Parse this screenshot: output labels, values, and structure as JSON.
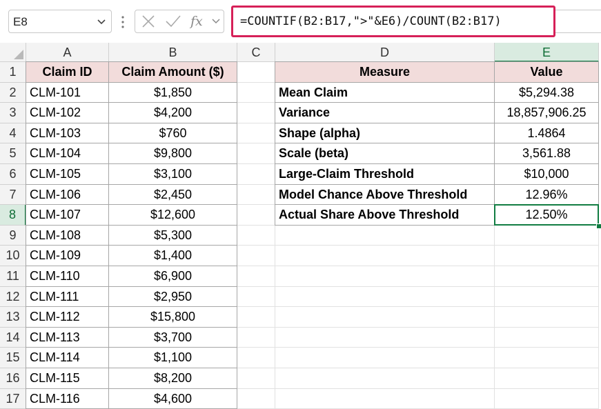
{
  "name_box": {
    "value": "E8"
  },
  "formula_bar": {
    "fx_label": "fx",
    "formula": "=COUNTIF(B2:B17,\">\"&E6)/COUNT(B2:B17)"
  },
  "column_headers": [
    "A",
    "B",
    "C",
    "D",
    "E"
  ],
  "row_headers": [
    "1",
    "2",
    "3",
    "4",
    "5",
    "6",
    "7",
    "8",
    "9",
    "10",
    "11",
    "12",
    "13",
    "14",
    "15",
    "16",
    "17"
  ],
  "selected_cell": "E8",
  "claims_table": {
    "headers": [
      "Claim ID",
      "Claim Amount ($)"
    ],
    "rows": [
      [
        "CLM-101",
        "$1,850"
      ],
      [
        "CLM-102",
        "$4,200"
      ],
      [
        "CLM-103",
        "$760"
      ],
      [
        "CLM-104",
        "$9,800"
      ],
      [
        "CLM-105",
        "$3,100"
      ],
      [
        "CLM-106",
        "$2,450"
      ],
      [
        "CLM-107",
        "$12,600"
      ],
      [
        "CLM-108",
        "$5,300"
      ],
      [
        "CLM-109",
        "$1,400"
      ],
      [
        "CLM-110",
        "$6,900"
      ],
      [
        "CLM-111",
        "$2,950"
      ],
      [
        "CLM-112",
        "$15,800"
      ],
      [
        "CLM-113",
        "$3,700"
      ],
      [
        "CLM-114",
        "$1,100"
      ],
      [
        "CLM-115",
        "$8,200"
      ],
      [
        "CLM-116",
        "$4,600"
      ]
    ]
  },
  "measures_table": {
    "headers": [
      "Measure",
      "Value"
    ],
    "rows": [
      [
        "Mean Claim",
        "$5,294.38"
      ],
      [
        "Variance",
        "18,857,906.25"
      ],
      [
        "Shape (alpha)",
        "1.4864"
      ],
      [
        "Scale (beta)",
        "3,561.88"
      ],
      [
        "Large-Claim Threshold",
        "$10,000"
      ],
      [
        "Model Chance Above Threshold",
        "12.96%"
      ],
      [
        "Actual Share Above Threshold",
        "12.50%"
      ]
    ]
  },
  "colors": {
    "header_fill": "#f2dcdb",
    "selection_green": "#107c41",
    "formula_highlight": "#d62058"
  }
}
